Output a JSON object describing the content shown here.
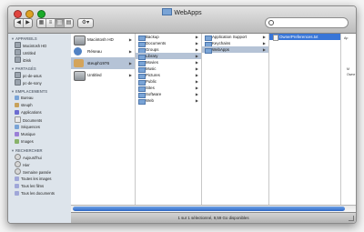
{
  "window": {
    "title": "WebApps"
  },
  "toolbar": {
    "back_label": "◀",
    "forward_label": "▶",
    "view_icon_label": "▦",
    "view_list_label": "≡",
    "view_column_label": "▥",
    "view_cover_label": "▤",
    "action_label": "⚙▾"
  },
  "search": {
    "placeholder": ""
  },
  "sidebar": {
    "sections": [
      {
        "title": "Appareils",
        "items": [
          {
            "label": "Macintosh HD",
            "icon": "hd-icon"
          },
          {
            "label": "Untitled",
            "icon": "hd-icon"
          },
          {
            "label": "iDisk",
            "icon": "hd-icon"
          }
        ]
      },
      {
        "title": "Partagés",
        "items": [
          {
            "label": "pc-de-asus",
            "icon": "computer-icon"
          },
          {
            "label": "pc-de-sony",
            "icon": "computer-icon"
          }
        ]
      },
      {
        "title": "Emplacements",
        "items": [
          {
            "label": "Bureau",
            "icon": "desktop-icon"
          },
          {
            "label": "steuph",
            "icon": "home-icon"
          },
          {
            "label": "Applications",
            "icon": "applications-icon"
          },
          {
            "label": "Documents",
            "icon": "documents-icon"
          },
          {
            "label": "Séquences",
            "icon": "movies-icon"
          },
          {
            "label": "Musique",
            "icon": "music-icon"
          },
          {
            "label": "Images",
            "icon": "pictures-icon"
          }
        ]
      },
      {
        "title": "Rechercher",
        "items": [
          {
            "label": "Aujourd'hui",
            "icon": "clock-icon"
          },
          {
            "label": "Hier",
            "icon": "clock-icon"
          },
          {
            "label": "Semaine passée",
            "icon": "clock-icon"
          },
          {
            "label": "Toutes les images",
            "icon": "smart-folder-icon"
          },
          {
            "label": "Tous les films",
            "icon": "smart-folder-icon"
          },
          {
            "label": "Tous les documents",
            "icon": "smart-folder-icon"
          }
        ]
      }
    ]
  },
  "columns": [
    {
      "items": [
        {
          "label": "Macintosh HD",
          "icon": "hd-icon",
          "arrow": true
        },
        {
          "label": "Réseau",
          "icon": "network-icon",
          "arrow": true
        },
        {
          "label": "steuph1976",
          "icon": "home-icon",
          "arrow": true,
          "selected": true
        },
        {
          "label": "Untitled",
          "icon": "hd-icon",
          "arrow": true
        }
      ]
    },
    {
      "items": [
        {
          "label": "Backup",
          "arrow": true
        },
        {
          "label": "Documents",
          "arrow": true
        },
        {
          "label": "Groups",
          "arrow": true
        },
        {
          "label": "Library",
          "arrow": true,
          "selected": true
        },
        {
          "label": "Movies",
          "arrow": true
        },
        {
          "label": "Music",
          "arrow": true
        },
        {
          "label": "Pictures",
          "arrow": true
        },
        {
          "label": "Public",
          "arrow": true
        },
        {
          "label": "Sites",
          "arrow": true
        },
        {
          "label": "Software",
          "arrow": true
        },
        {
          "label": "Web",
          "arrow": true
        }
      ]
    },
    {
      "items": [
        {
          "label": "Application Support",
          "arrow": true
        },
        {
          "label": "Keychains",
          "arrow": true
        },
        {
          "label": "WebApps",
          "arrow": true,
          "selected": true
        }
      ]
    },
    {
      "items": [
        {
          "label": "OwnerPreferences.txt",
          "file": true,
          "active": true
        }
      ]
    }
  ],
  "preview": {
    "lines": [
      "Ap",
      "M",
      "Owne"
    ]
  },
  "status": {
    "text": "1 sur 1 sélectionné, 9,59 Go disponibles"
  },
  "scrollbar": {
    "position": 0.98
  }
}
